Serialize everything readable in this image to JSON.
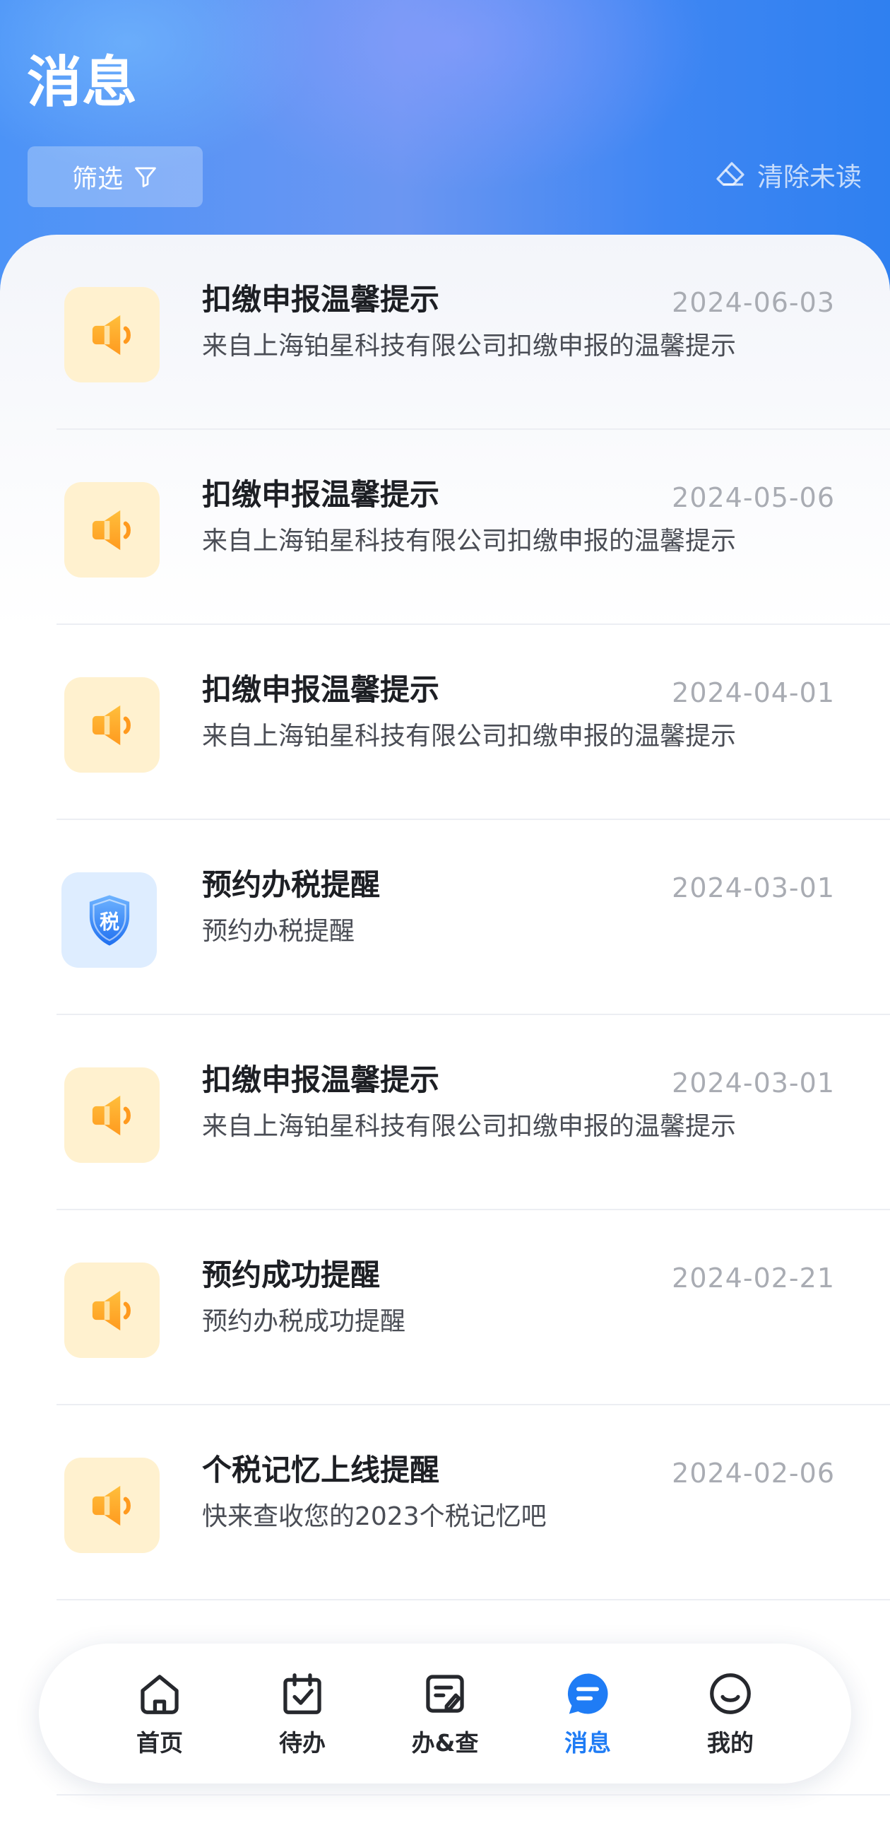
{
  "header": {
    "title": "消息",
    "filter_label": "筛选",
    "clear_label": "清除未读"
  },
  "messages": [
    {
      "title": "扣缴申报温馨提示",
      "subtitle": "来自上海铂星科技有限公司扣缴申报的温馨提示",
      "date": "2024-06-03",
      "icon": "speaker-icon"
    },
    {
      "title": "扣缴申报温馨提示",
      "subtitle": "来自上海铂星科技有限公司扣缴申报的温馨提示",
      "date": "2024-05-06",
      "icon": "speaker-icon"
    },
    {
      "title": "扣缴申报温馨提示",
      "subtitle": "来自上海铂星科技有限公司扣缴申报的温馨提示",
      "date": "2024-04-01",
      "icon": "speaker-icon"
    },
    {
      "title": "预约办税提醒",
      "subtitle": "预约办税提醒",
      "date": "2024-03-01",
      "icon": "tax-shield-icon",
      "icon_text": "税"
    },
    {
      "title": "扣缴申报温馨提示",
      "subtitle": "来自上海铂星科技有限公司扣缴申报的温馨提示",
      "date": "2024-03-01",
      "icon": "speaker-icon"
    },
    {
      "title": "预约成功提醒",
      "subtitle": "预约办税成功提醒",
      "date": "2024-02-21",
      "icon": "speaker-icon"
    },
    {
      "title": "个税记忆上线提醒",
      "subtitle": "快来查收您的2023个税记忆吧",
      "date": "2024-02-06",
      "icon": "speaker-icon"
    }
  ],
  "tabbar": {
    "items": [
      {
        "label": "首页",
        "icon": "home-icon"
      },
      {
        "label": "待办",
        "icon": "calendar-check-icon"
      },
      {
        "label": "办&查",
        "icon": "edit-doc-icon"
      },
      {
        "label": "消息",
        "icon": "message-icon",
        "active": true
      },
      {
        "label": "我的",
        "icon": "smile-icon"
      }
    ]
  },
  "colors": {
    "accent": "#1f7cf5",
    "header_blue": "#3e86f3",
    "speaker_orange": "#ffa726",
    "speaker_tile": "#fff1cf"
  }
}
